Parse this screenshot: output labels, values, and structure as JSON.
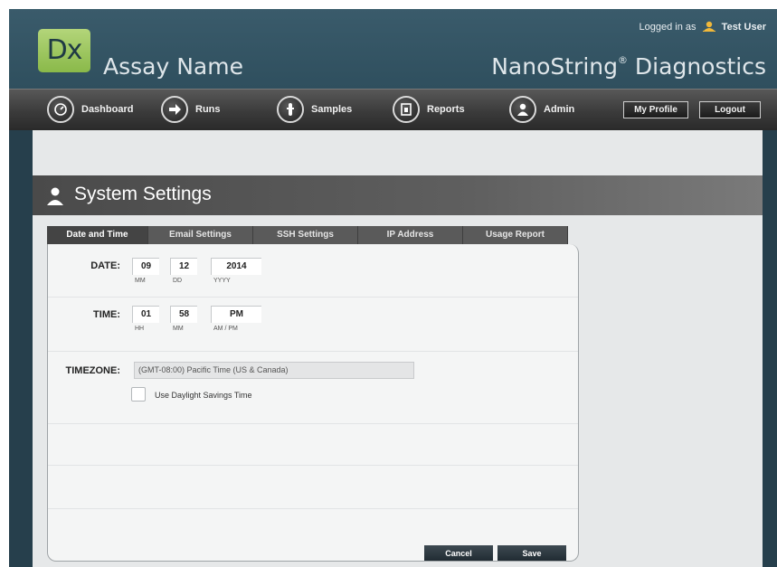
{
  "header": {
    "logo_text": "Dx",
    "assay_name": "Assay Name",
    "brand_name": "NanoString",
    "brand_mark": "®",
    "brand_suffix": " Diagnostics",
    "login_prefix": "Logged in as",
    "user_name": "Test User",
    "user_icon": "user-icon"
  },
  "nav": {
    "items": [
      {
        "label": "Dashboard",
        "icon": "dashboard-icon"
      },
      {
        "label": "Runs",
        "icon": "arrow-right-icon"
      },
      {
        "label": "Samples",
        "icon": "samples-icon"
      },
      {
        "label": "Reports",
        "icon": "reports-icon"
      },
      {
        "label": "Admin",
        "icon": "admin-user-icon"
      }
    ],
    "my_profile": "My Profile",
    "logout": "Logout"
  },
  "page": {
    "title": "System Settings",
    "title_icon": "admin-user-icon"
  },
  "tabs": [
    {
      "label": "Date and Time",
      "active": true
    },
    {
      "label": "Email Settings",
      "active": false
    },
    {
      "label": "SSH Settings",
      "active": false
    },
    {
      "label": "IP Address",
      "active": false
    },
    {
      "label": "Usage Report",
      "active": false
    }
  ],
  "form": {
    "date_label": "DATE:",
    "date_month": "09",
    "date_day": "12",
    "date_year": "2014",
    "date_month_hint": "MM",
    "date_day_hint": "DD",
    "date_year_hint": "YYYY",
    "time_label": "TIME:",
    "time_hour": "01",
    "time_minute": "58",
    "time_ampm": "PM",
    "time_hour_hint": "HH",
    "time_minute_hint": "MM",
    "time_ampm_hint": "AM / PM",
    "timezone_label": "TIMEZONE:",
    "timezone_value": "(GMT-08:00) Pacific Time (US & Canada)",
    "dst_label": "Use Daylight Savings Time",
    "dst_checked": false
  },
  "buttons": {
    "cancel": "Cancel",
    "save": "Save"
  },
  "colors": {
    "header_bg": "#2f4f5e",
    "logo_green": "#9cc75f",
    "nav_bg": "#3b3b3b",
    "rail": "#263f4c"
  }
}
